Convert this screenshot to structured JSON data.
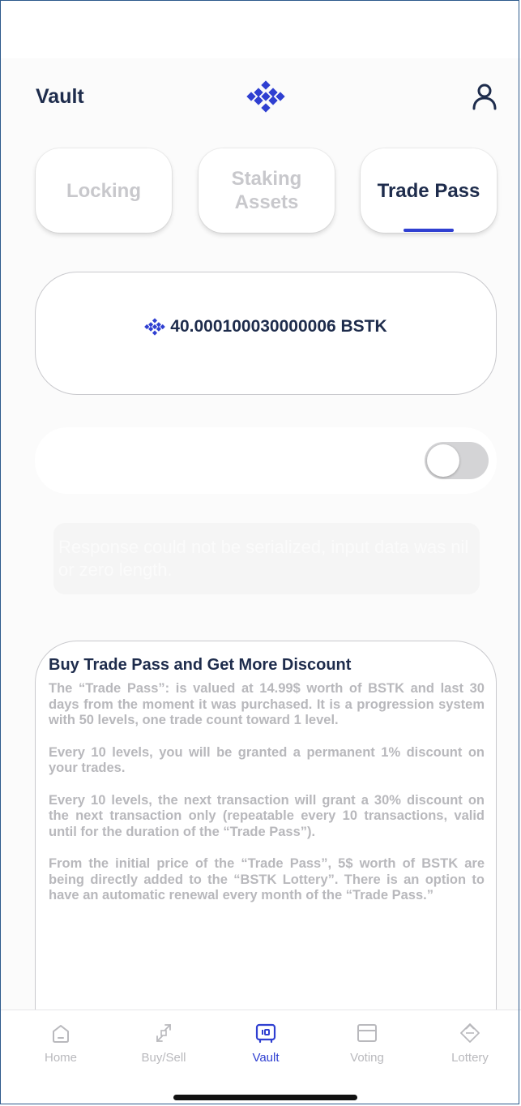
{
  "header": {
    "title": "Vault",
    "logo_icon": "bstk-logo-icon",
    "profile_icon": "user-icon"
  },
  "tabs": [
    {
      "label": "Locking",
      "active": false
    },
    {
      "label": "Staking Assets",
      "active": false
    },
    {
      "label": "Trade Pass",
      "active": true
    }
  ],
  "balance": {
    "icon": "bstk-logo-icon",
    "text": "40.000100030000006 BSTK"
  },
  "auto_renew_toggle": {
    "on": false
  },
  "error_message": "Response could not be serialized, input data was nil or zero length.",
  "info": {
    "title": "Buy Trade Pass and Get More Discount",
    "paragraphs": [
      "The “Trade Pass”: is valued at 14.99$ worth of BSTK and last 30 days from the moment it was purchased. It is a progression system with 50 levels, one trade count toward 1 level.",
      "Every 10 levels, you will be granted a permanent 1% discount on your trades.",
      "Every 10 levels, the next transaction will grant a 30% discount on the next transaction only (repeatable every 10 transactions, valid until for the duration of the “Trade Pass”).",
      "From the initial price of the “Trade Pass”, 5$ worth of BSTK are being directly added to the “BSTK Lottery”. There is an option to have an automatic renewal every month of the “Trade Pass.”"
    ]
  },
  "bottom_nav": [
    {
      "label": "Home",
      "icon": "home-icon",
      "active": false
    },
    {
      "label": "Buy/Sell",
      "icon": "swap-icon",
      "active": false
    },
    {
      "label": "Vault",
      "icon": "vault-icon",
      "active": true
    },
    {
      "label": "Voting",
      "icon": "ballot-icon",
      "active": false
    },
    {
      "label": "Lottery",
      "icon": "ticket-icon",
      "active": false
    }
  ],
  "colors": {
    "accent": "#2f3fd1",
    "text_dark": "#1e2c4c",
    "text_muted": "#b8b8bc"
  }
}
